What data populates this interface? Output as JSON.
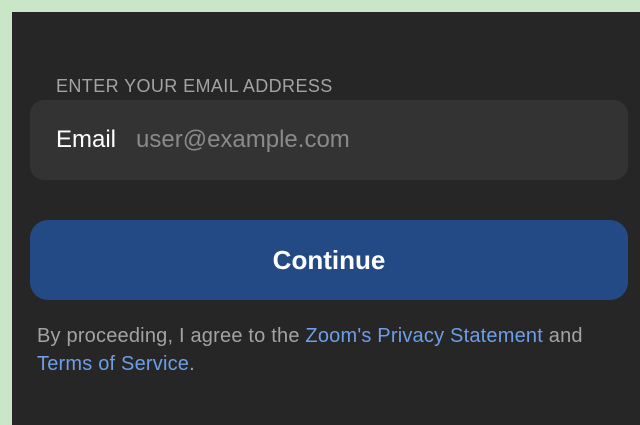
{
  "form": {
    "section_label": "ENTER YOUR EMAIL ADDRESS",
    "email_label": "Email",
    "email_placeholder": "user@example.com",
    "email_value": ""
  },
  "actions": {
    "continue_label": "Continue"
  },
  "legal": {
    "prefix": "By proceeding, I agree to the ",
    "privacy_link": "Zoom's Privacy Statement",
    "middle": " and ",
    "terms_link": "Terms of Service",
    "suffix": "."
  },
  "colors": {
    "background": "#262626",
    "field_background": "#333333",
    "button_background": "#244a85",
    "link": "#6d9ee6",
    "muted_text": "#a3a3a6",
    "frame": "#c9e6c6"
  }
}
